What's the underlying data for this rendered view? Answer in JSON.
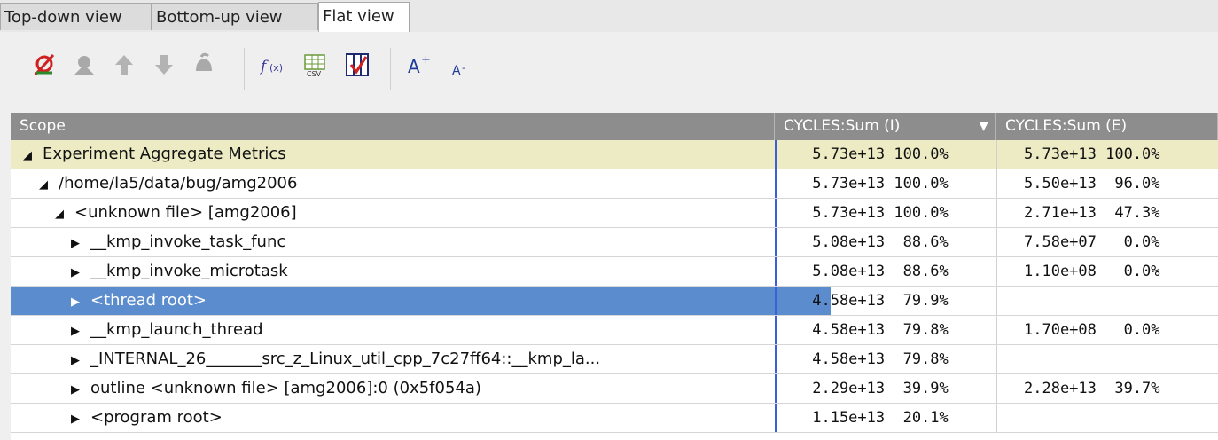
{
  "tabs": [
    "Top-down view",
    "Bottom-up view",
    "Flat view"
  ],
  "active_tab": "Flat view",
  "toolbar": {
    "icons": [
      "zoom-out-red-icon",
      "zoom-in-icon",
      "flatten-up-icon",
      "unflatten-down-icon",
      "hot-path-icon",
      "derived-metric-fx-icon",
      "export-csv-icon",
      "column-select-icon",
      "font-increase-icon",
      "font-decrease-icon"
    ]
  },
  "table": {
    "headers": [
      "Scope",
      "CYCLES:Sum (I)",
      "CYCLES:Sum (E)"
    ],
    "rows": [
      {
        "scope": "Experiment Aggregate Metrics",
        "indent": 0,
        "tri": "◢",
        "i_val": "5.73e+13",
        "i_pct": "100.0%",
        "e_val": "5.73e+13",
        "e_pct": "100.0%"
      },
      {
        "scope": "/home/la5/data/bug/amg2006",
        "indent": 1,
        "tri": "◢",
        "i_val": "5.73e+13",
        "i_pct": "100.0%",
        "e_val": "5.50e+13",
        "e_pct": "96.0%"
      },
      {
        "scope": "<unknown file> [amg2006]",
        "indent": 2,
        "tri": "◢",
        "i_val": "5.73e+13",
        "i_pct": "100.0%",
        "e_val": "2.71e+13",
        "e_pct": "47.3%"
      },
      {
        "scope": "__kmp_invoke_task_func",
        "indent": 3,
        "tri": "▶",
        "i_val": "5.08e+13",
        "i_pct": "88.6%",
        "e_val": "7.58e+07",
        "e_pct": "0.0%"
      },
      {
        "scope": "__kmp_invoke_microtask",
        "indent": 3,
        "tri": "▶",
        "i_val": "5.08e+13",
        "i_pct": "88.6%",
        "e_val": "1.10e+08",
        "e_pct": "0.0%"
      },
      {
        "scope": "<thread root>",
        "indent": 3,
        "tri": "▶",
        "i_val": "4.58e+13",
        "i_pct": "79.9%",
        "e_val": "",
        "e_pct": ""
      },
      {
        "scope": "__kmp_launch_thread",
        "indent": 3,
        "tri": "▶",
        "i_val": "4.58e+13",
        "i_pct": "79.8%",
        "e_val": "1.70e+08",
        "e_pct": "0.0%"
      },
      {
        "scope": "_INTERNAL_26_______src_z_Linux_util_cpp_7c27ff64::__kmp_la...",
        "indent": 3,
        "tri": "▶",
        "i_val": "4.58e+13",
        "i_pct": "79.8%",
        "e_val": "",
        "e_pct": ""
      },
      {
        "scope": "outline <unknown file> [amg2006]:0 (0x5f054a)",
        "indent": 3,
        "tri": "▶",
        "i_val": "2.29e+13",
        "i_pct": "39.9%",
        "e_val": "2.28e+13",
        "e_pct": "39.7%"
      },
      {
        "scope": "<program root>",
        "indent": 3,
        "tri": "▶",
        "i_val": "1.15e+13",
        "i_pct": "20.1%",
        "e_val": "",
        "e_pct": ""
      }
    ]
  }
}
